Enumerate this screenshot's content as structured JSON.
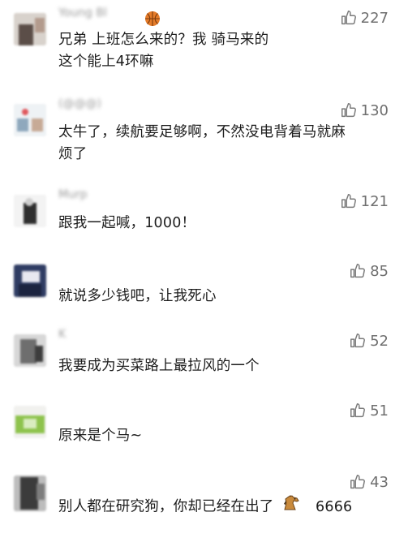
{
  "comments": [
    {
      "name": "Young Bl",
      "name_emoji": "basketball-emoji",
      "likes": "227",
      "text_lines": [
        "兄弟 上班怎么来的？我 骑马来的",
        "这个能上4环嘛"
      ]
    },
    {
      "name": "(@@@)",
      "likes": "130",
      "text_lines": [
        "太牛了，续航要足够啊，不然没电背着马就麻",
        "烦了"
      ]
    },
    {
      "name": "Murp",
      "likes": "121",
      "text_lines": [
        "跟我一起喊，1000！"
      ]
    },
    {
      "name": "",
      "likes": "85",
      "text_lines": [
        "就说多少钱吧，让我死心"
      ]
    },
    {
      "name": "K",
      "likes": "52",
      "text_lines": [
        "我要成为买菜路上最拉风的一个"
      ]
    },
    {
      "name": "",
      "likes": "51",
      "text_lines": [
        "原来是个马~"
      ]
    },
    {
      "name": "",
      "likes": "43",
      "text_lines": [
        "别人都在研究狗，你却已经在出了",
        "6666"
      ],
      "inline_emoji": "horse-emoji"
    }
  ],
  "colors": {
    "text": "#1d1d1d",
    "secondary": "#9a9a9a",
    "like_icon": "#7a7a7a"
  }
}
